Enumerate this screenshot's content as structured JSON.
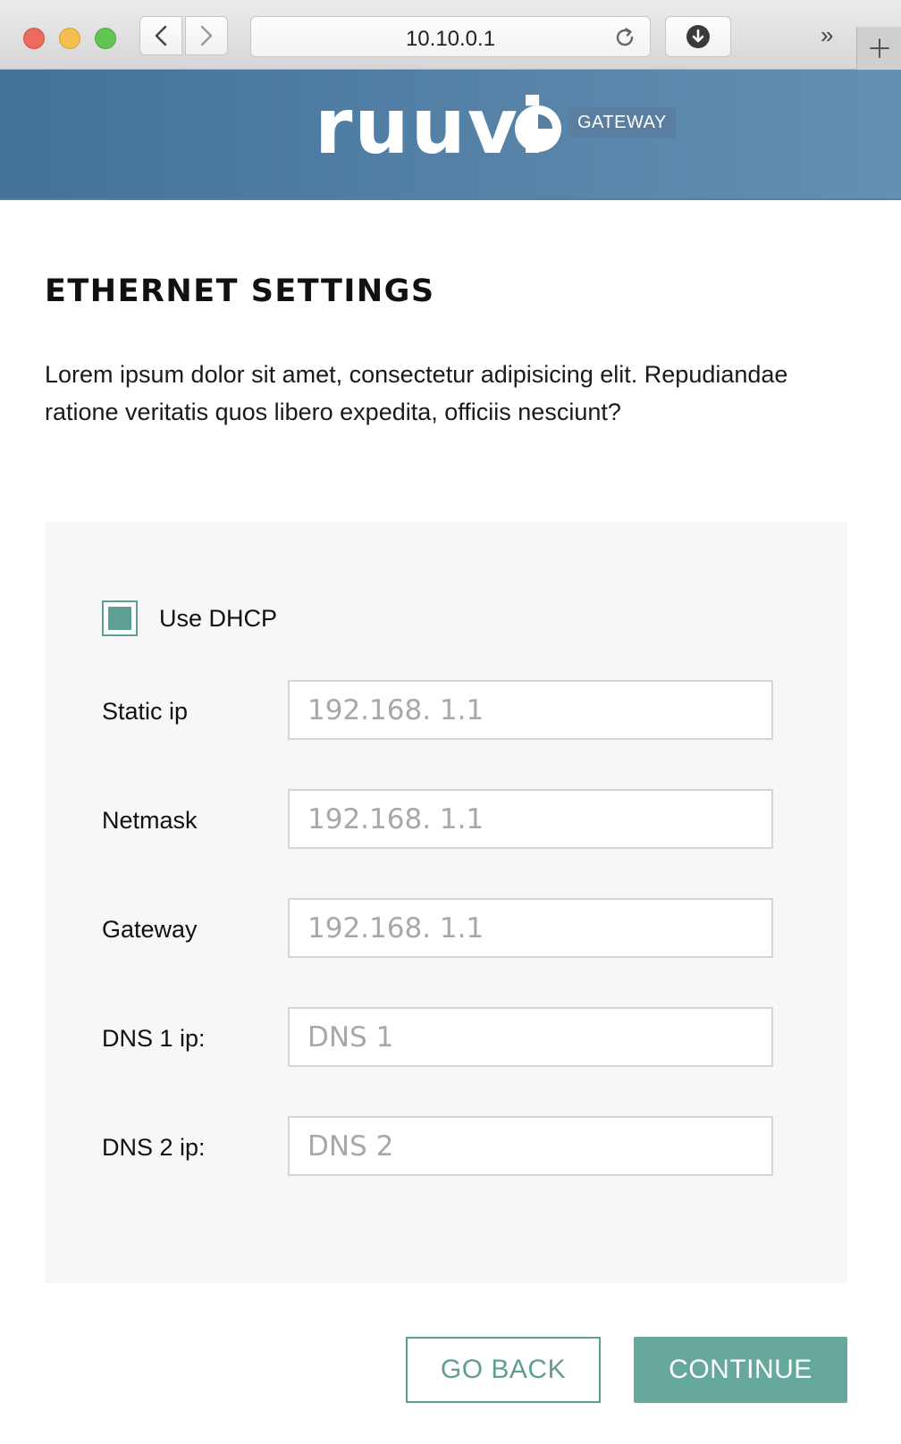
{
  "browser": {
    "url": "10.10.0.1",
    "back_icon": "chevron-left-icon",
    "forward_icon": "chevron-right-icon",
    "reload_icon": "reload-icon",
    "download_icon": "download-icon",
    "more_label": "»",
    "new_tab_icon": "plus-icon"
  },
  "header": {
    "logo_text": "ruuvi",
    "badge": "GATEWAY",
    "color_start": "#43719a",
    "color_end": "#6590b3"
  },
  "page": {
    "title": "ETHERNET SETTINGS",
    "description": "Lorem ipsum dolor sit amet, consectetur adipisicing elit. Repudiandae ratione veritatis quos libero expedita, officiis nesciunt?"
  },
  "form": {
    "dhcp": {
      "label": "Use DHCP",
      "checked": true
    },
    "static_ip": {
      "label": "Static ip",
      "placeholder": "192.168. 1.1",
      "value": ""
    },
    "netmask": {
      "label": "Netmask",
      "placeholder": "192.168. 1.1",
      "value": ""
    },
    "gateway": {
      "label": "Gateway",
      "placeholder": "192.168. 1.1",
      "value": ""
    },
    "dns1": {
      "label": "DNS 1 ip:",
      "placeholder": "DNS 1",
      "value": ""
    },
    "dns2": {
      "label": "DNS 2 ip:",
      "placeholder": "DNS 2",
      "value": ""
    }
  },
  "actions": {
    "back_label": "GO BACK",
    "continue_label": "CONTINUE",
    "accent_color": "#5f9e93"
  }
}
